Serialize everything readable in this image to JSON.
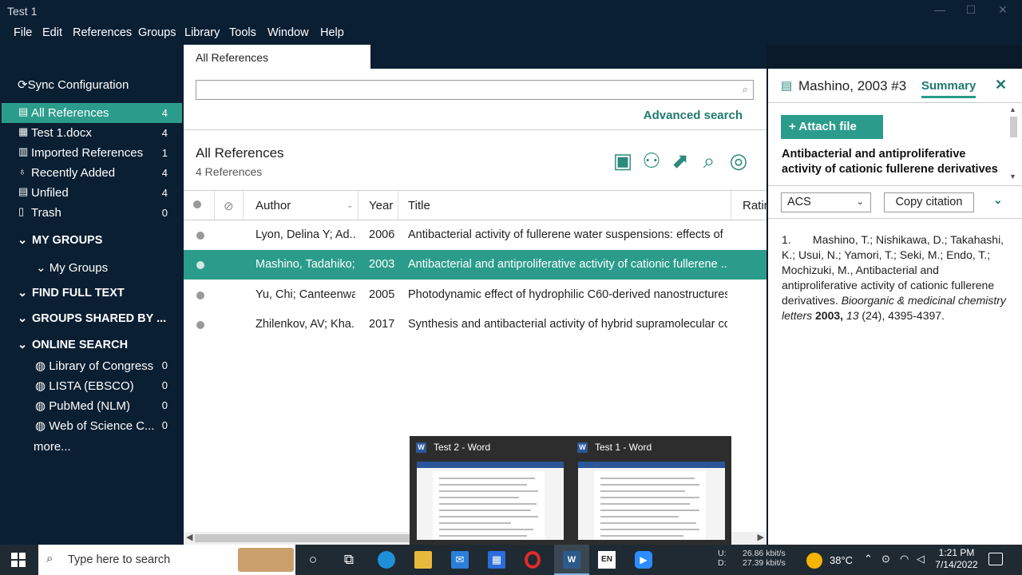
{
  "window": {
    "title": "Test 1",
    "minimize": "—",
    "maximize": "☐",
    "close": "✕"
  },
  "menu": [
    "File",
    "Edit",
    "References",
    "Groups",
    "Library",
    "Tools",
    "Window",
    "Help"
  ],
  "sidebar": {
    "sync": "Sync Configuration",
    "items": [
      {
        "label": "All References",
        "count": "4",
        "icon": "clipboard-icon"
      },
      {
        "label": "Test 1.docx",
        "count": "4",
        "icon": "word-doc-icon"
      },
      {
        "label": "Imported References",
        "count": "1",
        "icon": "import-icon"
      },
      {
        "label": "Recently Added",
        "count": "4",
        "icon": "bell-icon"
      },
      {
        "label": "Unfiled",
        "count": "4",
        "icon": "clipboard-icon"
      },
      {
        "label": "Trash",
        "count": "0",
        "icon": "trash-icon"
      }
    ],
    "my_groups_header": "MY GROUPS",
    "my_groups_sub": "My Groups",
    "find_full_text": "FIND FULL TEXT",
    "groups_shared": "GROUPS SHARED BY ...",
    "online_search": "ONLINE SEARCH",
    "online": [
      {
        "label": "Library of Congress",
        "count": "0"
      },
      {
        "label": "LISTA (EBSCO)",
        "count": "0"
      },
      {
        "label": "PubMed (NLM)",
        "count": "0"
      },
      {
        "label": "Web of Science C...",
        "count": "0"
      }
    ],
    "more": "more..."
  },
  "center": {
    "tab": "All References",
    "search_placeholder": "",
    "advanced_search": "Advanced search",
    "library_title": "All References",
    "library_count": "4 References",
    "columns": {
      "author": "Author",
      "year": "Year",
      "title": "Title",
      "rating": "Ratin"
    },
    "rows": [
      {
        "author": "Lyon, Delina Y; Ad...",
        "year": "2006",
        "title": "Antibacterial activity of fullerene water suspensions: effects of ..."
      },
      {
        "author": "Mashino, Tadahiko;...",
        "year": "2003",
        "title": "Antibacterial and antiproliferative activity of cationic fullerene ..."
      },
      {
        "author": "Yu, Chi; Canteenwa...",
        "year": "2005",
        "title": "Photodynamic effect of hydrophilic C60-derived nanostructures..."
      },
      {
        "author": "Zhilenkov, AV; Kha...",
        "year": "2017",
        "title": "Synthesis and antibacterial activity of hybrid supramolecular co..."
      }
    ]
  },
  "right_panel": {
    "ref_label": "Mashino, 2003 #3",
    "summary_tab": "Summary",
    "attach_file": "Attach file",
    "ref_title": "Antibacterial and antiproliferative activity of cationic fullerene derivatives",
    "style": "ACS",
    "copy_citation": "Copy citation",
    "citation": {
      "num": "1.",
      "authors": "Mashino, T.; Nishikawa, D.; Takahashi, K.; Usui, N.; Yamori, T.; Seki, M.; Endo, T.; Mochizuki, M., Antibacterial and antiproliferative activity of cationic fullerene derivatives.",
      "journal": "Bioorganic & medicinal chemistry letters",
      "year": "2003,",
      "volume": "13",
      "rest": "(24), 4395-4397."
    }
  },
  "taskbar_popup": [
    {
      "title": "Test 2 - Word"
    },
    {
      "title": "Test 1 - Word"
    }
  ],
  "taskbar": {
    "search_placeholder": "Type here to search",
    "net_labels": "U:\nD:",
    "net_up": "26.86 kbit/s",
    "net_down": "27.39 kbit/s",
    "temperature": "38°C",
    "time": "1:21 PM",
    "date": "7/14/2022",
    "lang": "EN"
  },
  "colors": {
    "accent": "#2b9c8b",
    "dark_bg": "#0b1f33",
    "link": "#1f7a6e"
  }
}
